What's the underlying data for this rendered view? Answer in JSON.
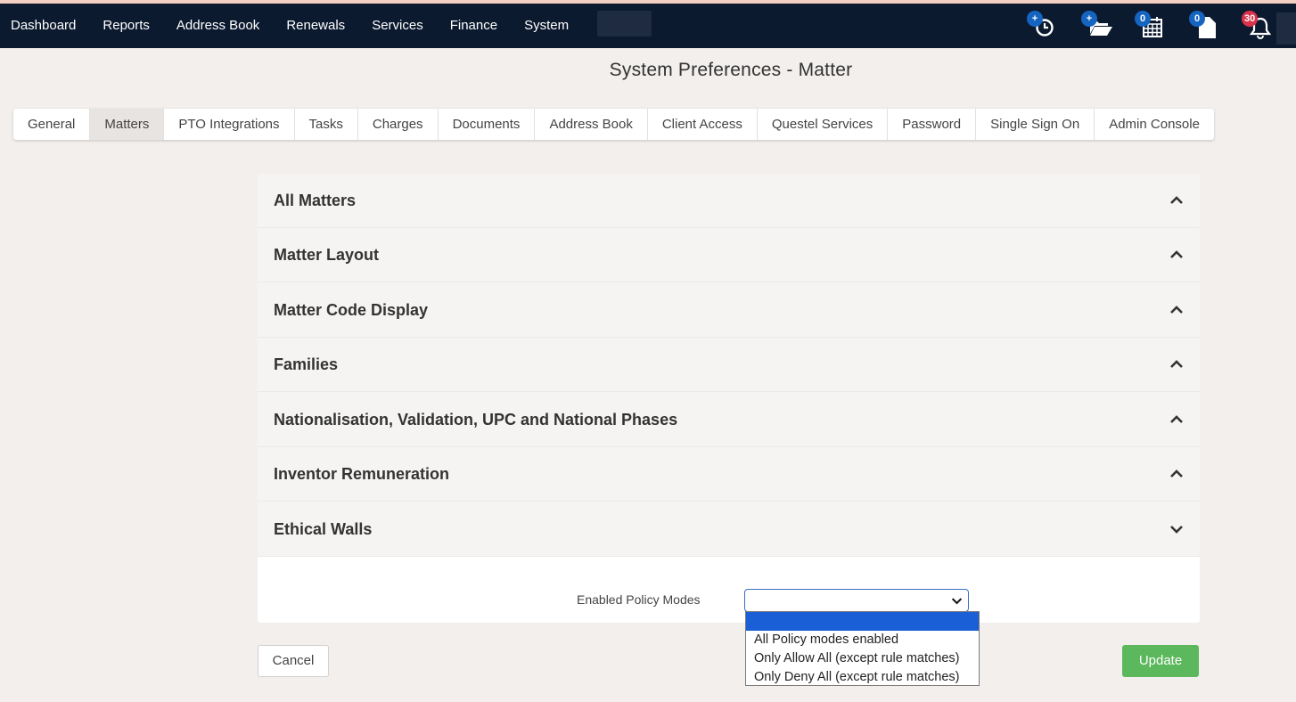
{
  "nav": {
    "items": [
      "Dashboard",
      "Reports",
      "Address Book",
      "Renewals",
      "Services",
      "Finance",
      "System"
    ],
    "badges": {
      "timer": "+",
      "folder": "+",
      "calendar": "0",
      "document": "0",
      "notifications": "30"
    }
  },
  "page": {
    "title": "System Preferences - Matter"
  },
  "tabs": [
    "General",
    "Matters",
    "PTO Integrations",
    "Tasks",
    "Charges",
    "Documents",
    "Address Book",
    "Client Access",
    "Questel Services",
    "Password",
    "Single Sign On",
    "Admin Console"
  ],
  "active_tab": "Matters",
  "sections": [
    {
      "label": "All Matters",
      "state": "collapsed"
    },
    {
      "label": "Matter Layout",
      "state": "collapsed"
    },
    {
      "label": "Matter Code Display",
      "state": "collapsed"
    },
    {
      "label": "Families",
      "state": "collapsed"
    },
    {
      "label": "Nationalisation, Validation, UPC and National Phases",
      "state": "collapsed"
    },
    {
      "label": "Inventor Remuneration",
      "state": "collapsed"
    },
    {
      "label": "Ethical Walls",
      "state": "expanded"
    }
  ],
  "ethical_walls": {
    "field_label": "Enabled Policy Modes",
    "selected_value": "",
    "options": [
      "",
      "All Policy modes enabled",
      "Only Allow All (except rule matches)",
      "Only Deny All (except rule matches)"
    ]
  },
  "buttons": {
    "cancel": "Cancel",
    "update": "Update"
  },
  "colors": {
    "navbar": "#0c1a30",
    "update": "#5cb85c",
    "badge_blue": "#1565c0",
    "badge_red": "#d9324a",
    "highlight": "#1a5fd6"
  }
}
